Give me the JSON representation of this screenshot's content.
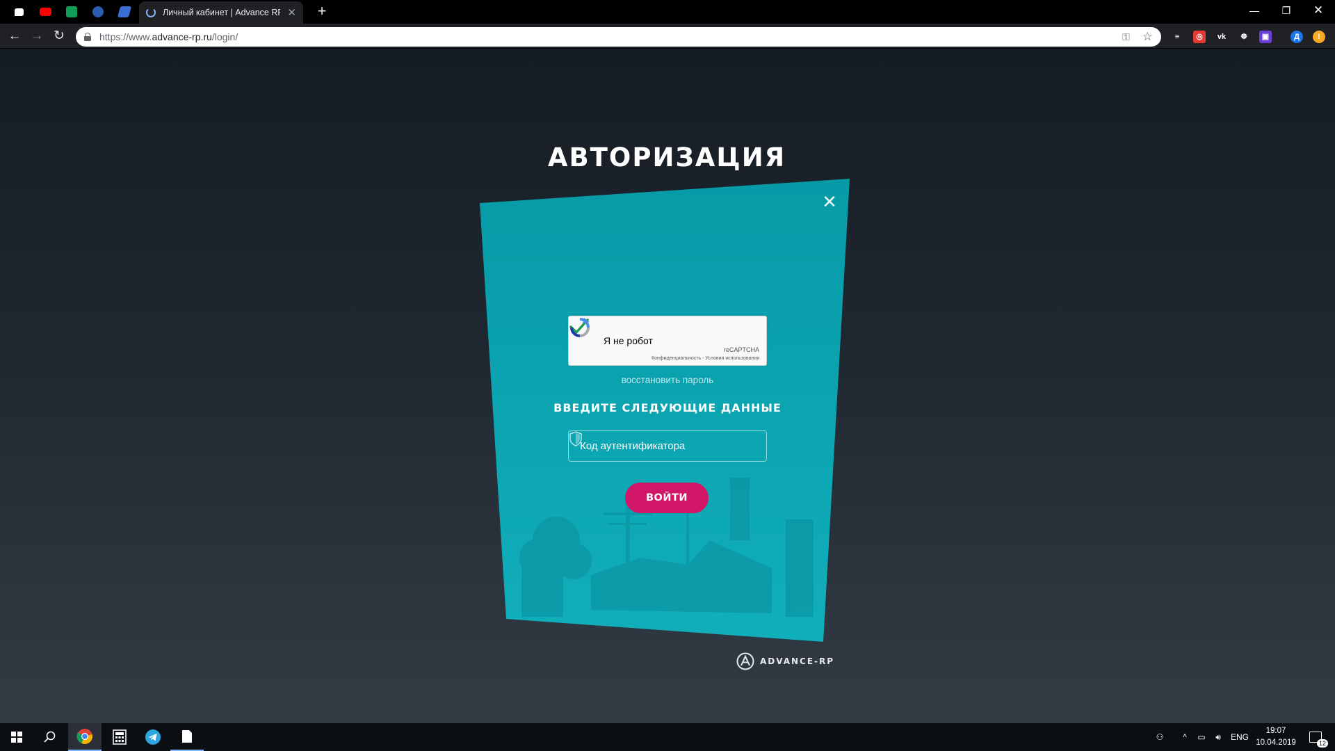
{
  "browser": {
    "active_tab_title": "Личный кабинет | Advance RP",
    "url_prefix": "https://www.",
    "url_domain": "advance-rp.ru",
    "url_path": "/login/",
    "pinned_tabs": [
      {
        "icon": "chat-icon",
        "color": "#1f1f1f"
      },
      {
        "icon": "youtube-icon",
        "color": "#ff0000"
      },
      {
        "icon": "sheets-icon",
        "color": "#0f9d58"
      },
      {
        "icon": "mail-icon",
        "color": "#2a5db0"
      },
      {
        "icon": "bookmark-icon",
        "color": "#3b6fd6"
      }
    ],
    "extensions": [
      {
        "icon": "reading-list-icon",
        "color": "#202124",
        "glyph": "≡"
      },
      {
        "icon": "adblock-icon",
        "color": "#e53935",
        "glyph": "◎"
      },
      {
        "icon": "vk-icon",
        "color": "#202124",
        "glyph": "vk"
      },
      {
        "icon": "vpn-icon",
        "color": "#202124",
        "glyph": "☸"
      },
      {
        "icon": "extension-icon",
        "color": "#6a3fd6",
        "glyph": "▣"
      },
      {
        "icon": "profile-avatar",
        "color": "#1a73e8",
        "glyph": "Д"
      },
      {
        "icon": "update-icon",
        "color": "#f9a825",
        "glyph": "!"
      }
    ]
  },
  "page": {
    "heading": "АВТОРИЗАЦИЯ",
    "recaptcha": {
      "label": "Я не робот",
      "brand": "reCAPTCHA",
      "terms": "Конфиденциальность - Условия использования",
      "checked": true
    },
    "recover_link": "восстановить пароль",
    "subheading": "ВВЕДИТЕ СЛЕДУЮЩИЕ ДАННЫЕ",
    "code_field": {
      "placeholder": "Код аутентификатора",
      "value": ""
    },
    "login_button": "ВОЙТИ",
    "brand": "ADVANCE-RP"
  },
  "colors": {
    "card": "#079aa7",
    "button": "#d11667"
  },
  "taskbar": {
    "language": "ENG",
    "time": "19:07",
    "date": "10.04.2019",
    "notification_count": "12"
  }
}
